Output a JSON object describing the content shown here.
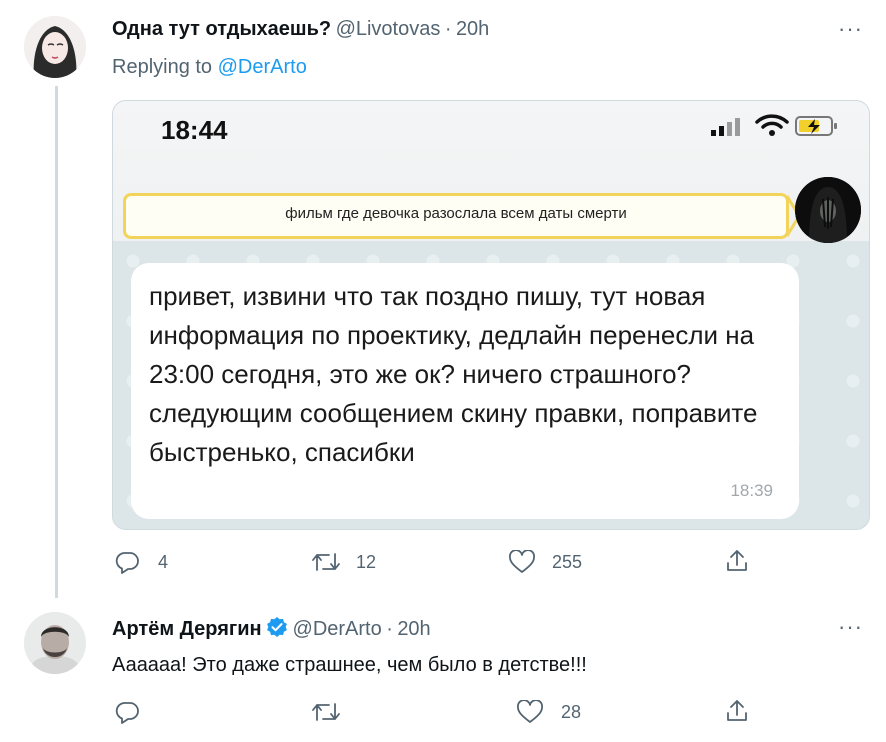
{
  "tweet1": {
    "display_name": "Одна тут отдыхаешь?",
    "handle": "@Livotovas",
    "separator": "·",
    "time": "20h",
    "more": "···",
    "replying_prefix": "Replying to",
    "replying_to": "@DerArto",
    "media": {
      "clock": "18:44",
      "chat_title": "фильм где девочка разослала всем даты смерти",
      "message": "привет, извини что так поздно пишу, тут новая информация по проектику, дедлайн перенесли на 23:00 сегодня, это же ок? ничего страшного? следующим сообщением скину правки, поправите быстренько, спасибки",
      "message_time": "18:39"
    },
    "actions": {
      "replies": "4",
      "retweets": "12",
      "likes": "255"
    }
  },
  "tweet2": {
    "display_name": "Артём Дерягин",
    "handle": "@DerArto",
    "separator": "·",
    "time": "20h",
    "more": "···",
    "text": "Аааааа! Это даже страшнее, чем было в детстве!!!",
    "actions": {
      "likes": "28"
    }
  },
  "colors": {
    "accent": "#1d9bf0",
    "secondary_text": "#536471",
    "chat_highlight": "#f2d45b"
  },
  "icons": [
    "reply-icon",
    "retweet-icon",
    "like-icon",
    "share-icon",
    "verified-badge-icon",
    "more-icon"
  ]
}
